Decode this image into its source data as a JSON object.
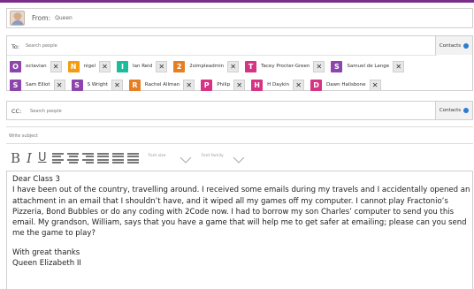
{
  "from": {
    "label": "From:",
    "name": "Queen"
  },
  "to": {
    "label": "To:",
    "placeholder": "Search people",
    "contacts_label": "Contacts",
    "recipients": [
      {
        "initial": "O",
        "name": "octavian",
        "color": "#8e44ad"
      },
      {
        "initial": "N",
        "name": "nigel",
        "color": "#f39c12"
      },
      {
        "initial": "I",
        "name": "Ian Reid",
        "color": "#1abc9c"
      },
      {
        "initial": "2",
        "name": "2simpleadmin",
        "color": "#e67e22"
      },
      {
        "initial": "T",
        "name": "Tacey Procter-Green",
        "color": "#d63384"
      },
      {
        "initial": "S",
        "name": "Samuel de Lange",
        "color": "#8e44ad"
      },
      {
        "initial": "S",
        "name": "Sam Elliot",
        "color": "#8e44ad"
      },
      {
        "initial": "S",
        "name": "S Wright",
        "color": "#8e44ad"
      },
      {
        "initial": "R",
        "name": "Rachel Allman",
        "color": "#e67e22"
      },
      {
        "initial": "P",
        "name": "Philip",
        "color": "#d63384"
      },
      {
        "initial": "H",
        "name": "H Daykin",
        "color": "#d63384"
      },
      {
        "initial": "D",
        "name": "Dawn Hallsbone",
        "color": "#d63384"
      }
    ]
  },
  "cc": {
    "label": "CC:",
    "placeholder": "Search people",
    "contacts_label": "Contacts"
  },
  "subject": {
    "placeholder": "Write subject"
  },
  "toolbar": {
    "bold": "B",
    "italic": "I",
    "underline": "U",
    "font_size_label": "Font size",
    "font_family_label": "Font family"
  },
  "message": {
    "greeting": "Dear Class 3",
    "paragraph": "I have been out of the country, travelling around. I received some emails during my travels and I accidentally opened an attachment in an email that I shouldn’t have, and it wiped all my games off my computer. I cannot play Fractonio’s Pizzeria, Bond Bubbles or do any coding with 2Code now. I had to borrow my son Charles’ computer to send you this email. My grandson, William, says that you have a game that will help me to get safer at emailing; please can you send me the game to play?",
    "closing": "With great thanks",
    "signature": "Queen Elizabeth II"
  },
  "colors": {
    "accent": "#7b2d8b",
    "contacts_icon": "#2b7cd3"
  }
}
